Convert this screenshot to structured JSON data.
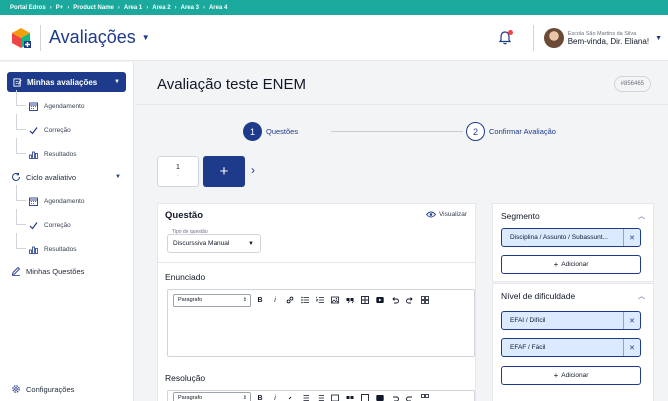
{
  "breadcrumb": [
    "Portal Edros",
    "P+",
    "Product Name",
    "Area 1",
    "Area 2",
    "Area 3",
    "Area 4"
  ],
  "header": {
    "app_title": "Avaliações",
    "school": "Escola São Martins da Silva",
    "welcome": "Bem-vinda, Dir. Eliana!"
  },
  "sidebar": {
    "active": "Minhas avaliações",
    "group1": [
      "Agendamento",
      "Correção",
      "Resultados"
    ],
    "cycle": "Ciclo avaliativo",
    "group2": [
      "Agendamento",
      "Correção",
      "Resultados"
    ],
    "questions": "Minhas Questões",
    "config": "Configurações"
  },
  "page": {
    "title": "Avaliação teste ENEM",
    "code": "#856465"
  },
  "stepper": [
    {
      "num": "1",
      "label": "Questões"
    },
    {
      "num": "2",
      "label": "Confirmar Avaliação"
    }
  ],
  "question_tabs": {
    "first_num": "1",
    "first_sub": "-",
    "add_label": "+",
    "next_label": "›"
  },
  "question": {
    "heading": "Questão",
    "visualize": "Visualizar",
    "type_label": "Tipo de questão",
    "type_value": "Discurssiva Manual",
    "statement_heading": "Enunciado",
    "resolution_heading": "Resolução",
    "paragraph_select": "Paragrafo"
  },
  "segment": {
    "heading": "Segmento",
    "chip": "Disciplina / Assunto / Subassunt...",
    "add": "Adicionar"
  },
  "difficulty": {
    "heading": "Nível de dificuldade",
    "chips": [
      "EFAI / Difícil",
      "EFAF / Fácil"
    ],
    "add": "Adicionar"
  },
  "colors": {
    "primary": "#1e3a8a",
    "teal": "#1aa99c",
    "chip_bg": "#dbeafe"
  }
}
